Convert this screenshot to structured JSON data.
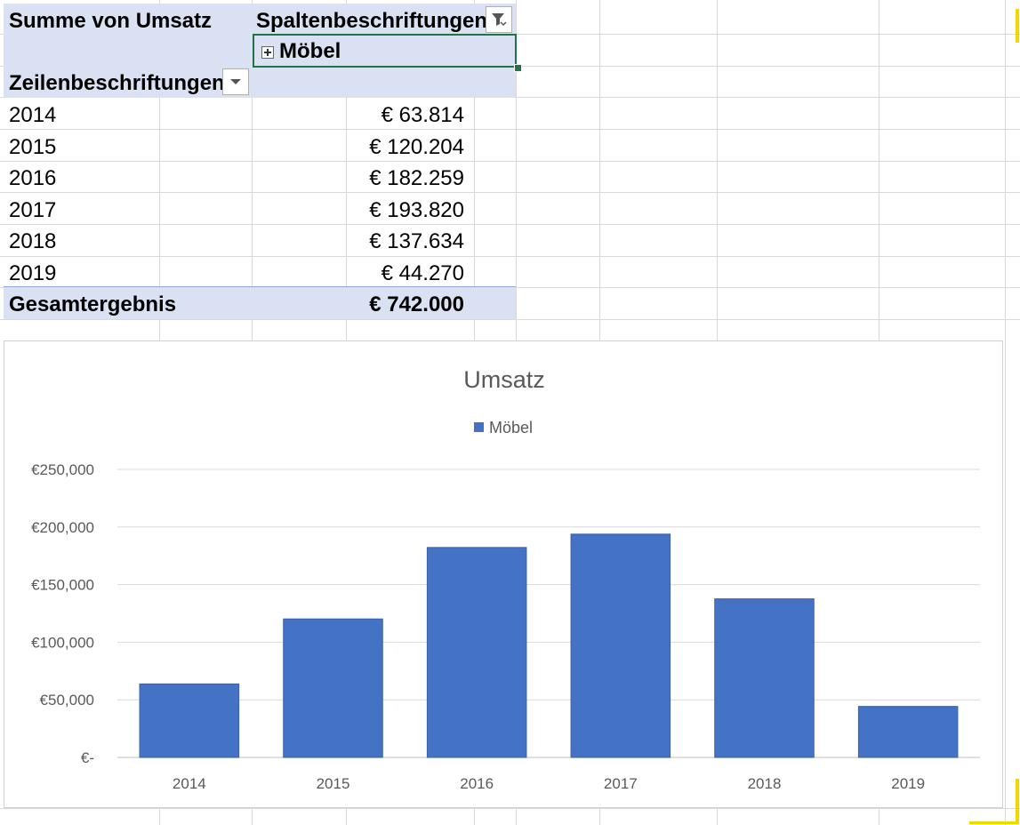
{
  "pivot": {
    "value_field": "Summe von Umsatz",
    "column_labels": "Spaltenbeschriftungen",
    "column_item": "Möbel",
    "row_labels": "Zeilenbeschriftungen",
    "rows": [
      {
        "year": "2014",
        "value": "€ 63.814"
      },
      {
        "year": "2015",
        "value": "€ 120.204"
      },
      {
        "year": "2016",
        "value": "€ 182.259"
      },
      {
        "year": "2017",
        "value": "€ 193.820"
      },
      {
        "year": "2018",
        "value": "€ 137.634"
      },
      {
        "year": "2019",
        "value": "€ 44.270"
      }
    ],
    "total_label": "Gesamtergebnis",
    "total_value": "€ 742.000"
  },
  "colors": {
    "bar": "#4472c4",
    "header_bg": "#d9e1f2",
    "selection": "#217346"
  },
  "chart_data": {
    "type": "bar",
    "title": "Umsatz",
    "legend": "top",
    "categories": [
      "2014",
      "2015",
      "2016",
      "2017",
      "2018",
      "2019"
    ],
    "series": [
      {
        "name": "Möbel",
        "values": [
          63814,
          120204,
          182259,
          193820,
          137634,
          44270
        ]
      }
    ],
    "ylim": [
      0,
      250000
    ],
    "yticks": [
      0,
      50000,
      100000,
      150000,
      200000,
      250000
    ],
    "ytick_labels": [
      "€-",
      "€50,000",
      "€100,000",
      "€150,000",
      "€200,000",
      "€250,000"
    ],
    "grid": true
  }
}
